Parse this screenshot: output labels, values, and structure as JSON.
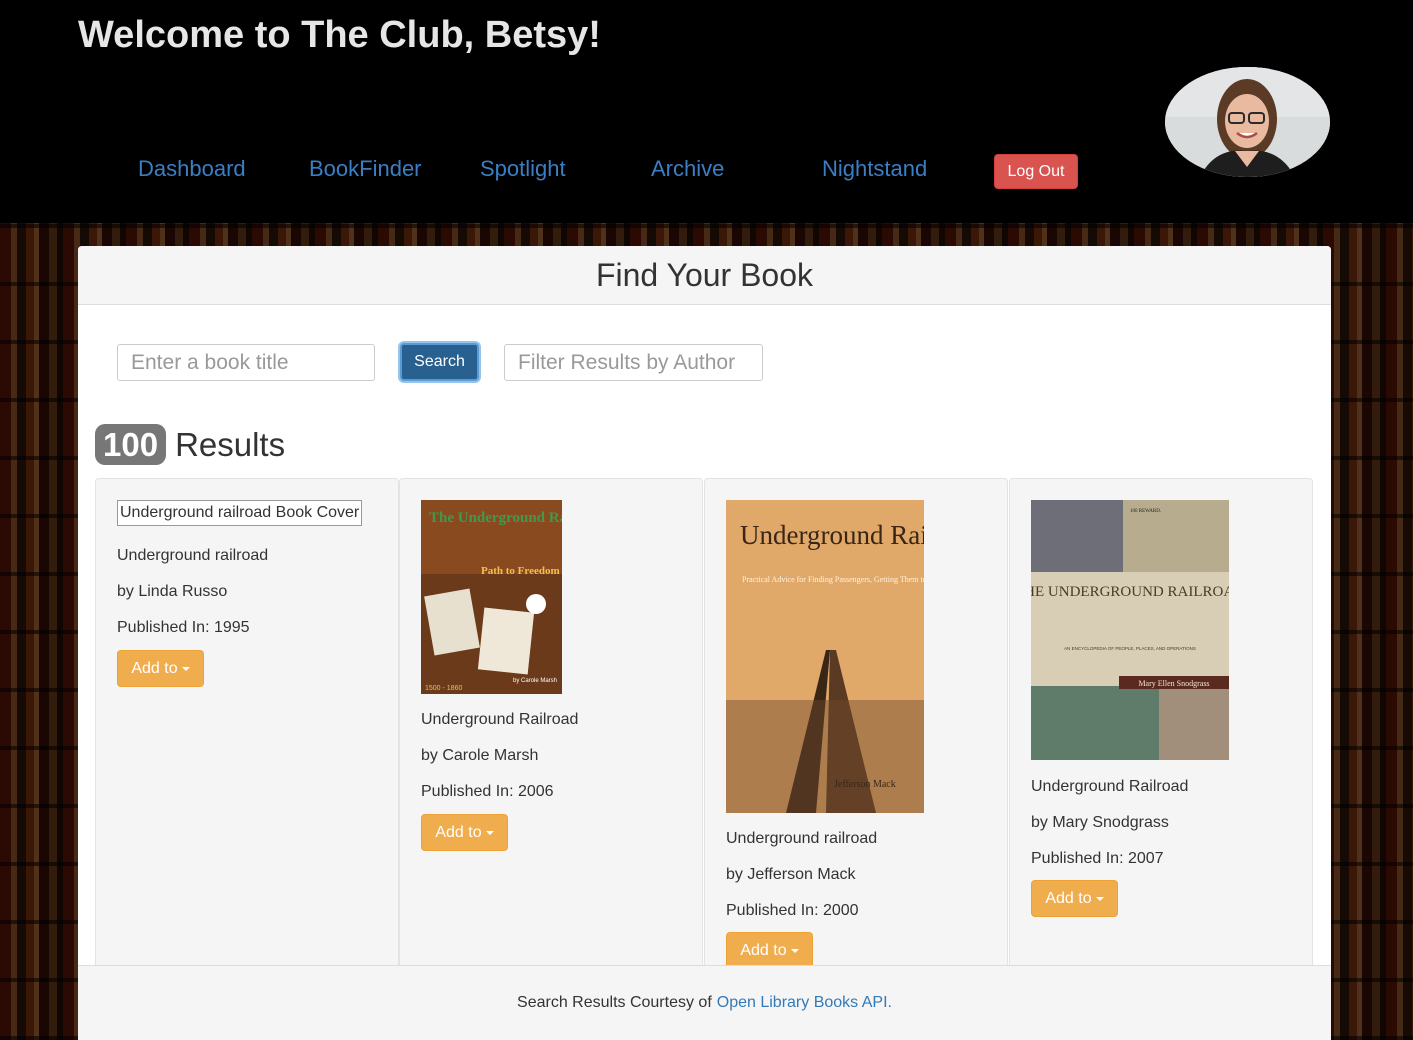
{
  "header": {
    "welcome": "Welcome to The Club, Betsy!",
    "nav": [
      "Dashboard",
      "BookFinder",
      "Spotlight",
      "Archive",
      "Nightstand"
    ],
    "logout_label": "Log Out"
  },
  "panel": {
    "title": "Find Your Book",
    "search_placeholder": "Enter a book title",
    "search_button": "Search",
    "filter_placeholder": "Filter Results by Author",
    "results_count": "100",
    "results_label": "Results"
  },
  "books": [
    {
      "cover_alt": "Underground railroad Book Cover",
      "title": "Underground railroad",
      "author": "by Linda Russo",
      "published": "Published In: 1995",
      "add_label": "Add to"
    },
    {
      "cover_text_1": "The Underground Railroad",
      "cover_text_2": "Path to Freedom",
      "cover_text_3": "1500 - 1860",
      "cover_text_4": "by Carole Marsh",
      "title": "Underground Railroad",
      "author": "by Carole Marsh",
      "published": "Published In: 2006",
      "add_label": "Add to"
    },
    {
      "cover_text_1": "Underground Railroad",
      "cover_text_2": "Practical Advice for Finding Passengers, Getting Them to Safety, and Staying One Step Ahead of the Tyrants",
      "cover_text_3": "Jefferson Mack",
      "title": "Underground railroad",
      "author": "by Jefferson Mack",
      "published": "Published In: 2000",
      "add_label": "Add to"
    },
    {
      "cover_text_1": "THE UNDERGROUND RAILROAD",
      "cover_text_2": "AN ENCYCLOPEDIA OF PEOPLE, PLACES, AND OPERATIONS",
      "cover_text_3": "Mary Ellen Snodgrass",
      "cover_text_4": "100 REWARD.",
      "title": "Underground Railroad",
      "author": "by Mary Snodgrass",
      "published": "Published In: 2007",
      "add_label": "Add to"
    }
  ],
  "footer": {
    "text": "Search Results Courtesy of",
    "link": "Open Library Books API."
  }
}
